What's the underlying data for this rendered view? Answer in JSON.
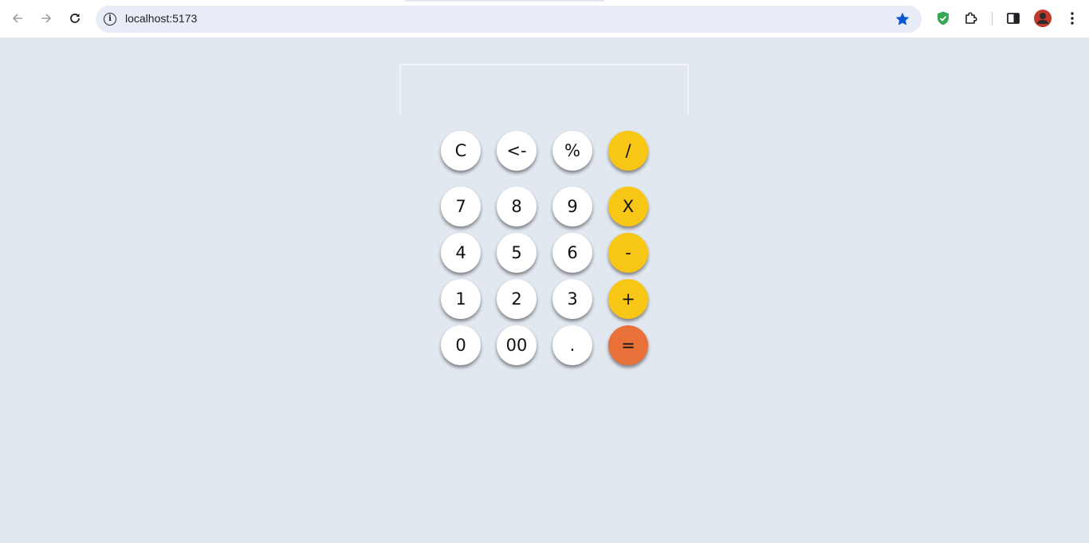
{
  "browser": {
    "url": "localhost:5173",
    "info_glyph": "i",
    "icons": {
      "back": "arrow-left-icon",
      "forward": "arrow-right-icon",
      "reload": "reload-icon",
      "site_info": "info-icon",
      "bookmark": "star-icon",
      "shield": "shield-check-icon",
      "extensions": "puzzle-icon",
      "side_panel": "side-panel-icon",
      "profile": "avatar",
      "menu": "kebab-menu-icon"
    },
    "colors": {
      "star": "#0b57d0",
      "shield": "#34a853"
    }
  },
  "calculator": {
    "display_value": "",
    "rows": [
      [
        {
          "label": "C",
          "style": "white"
        },
        {
          "label": "<-",
          "style": "white"
        },
        {
          "label": "%",
          "style": "white"
        },
        {
          "label": "/",
          "style": "yellow"
        }
      ],
      [
        {
          "label": "7",
          "style": "white"
        },
        {
          "label": "8",
          "style": "white"
        },
        {
          "label": "9",
          "style": "white"
        },
        {
          "label": "X",
          "style": "yellow"
        }
      ],
      [
        {
          "label": "4",
          "style": "white"
        },
        {
          "label": "5",
          "style": "white"
        },
        {
          "label": "6",
          "style": "white"
        },
        {
          "label": "-",
          "style": "yellow"
        }
      ],
      [
        {
          "label": "1",
          "style": "white"
        },
        {
          "label": "2",
          "style": "white"
        },
        {
          "label": "3",
          "style": "white"
        },
        {
          "label": "+",
          "style": "yellow"
        }
      ],
      [
        {
          "label": "0",
          "style": "white"
        },
        {
          "label": "00",
          "style": "white"
        },
        {
          "label": ".",
          "style": "white"
        },
        {
          "label": "=",
          "style": "orange"
        }
      ]
    ],
    "colors": {
      "white": "#ffffff",
      "yellow": "#f8c614",
      "orange": "#e8713a",
      "background": "#e2e8f0"
    }
  }
}
